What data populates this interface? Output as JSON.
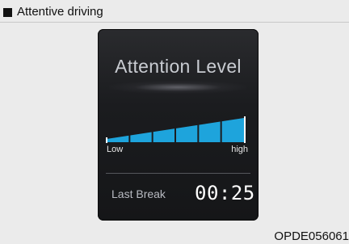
{
  "caption": {
    "text": "Attentive driving",
    "bullet_icon": "black-square-icon"
  },
  "display": {
    "title": "Attention Level",
    "gauge": {
      "segments": 6,
      "level": 1.0,
      "fill_color": "#1ea4dc",
      "low_label": "Low",
      "high_label": "high"
    },
    "last_break_label": "Last Break",
    "last_break_time": "00:25",
    "background_color": "#1b1c1f"
  },
  "figure_code": "OPDE056061"
}
